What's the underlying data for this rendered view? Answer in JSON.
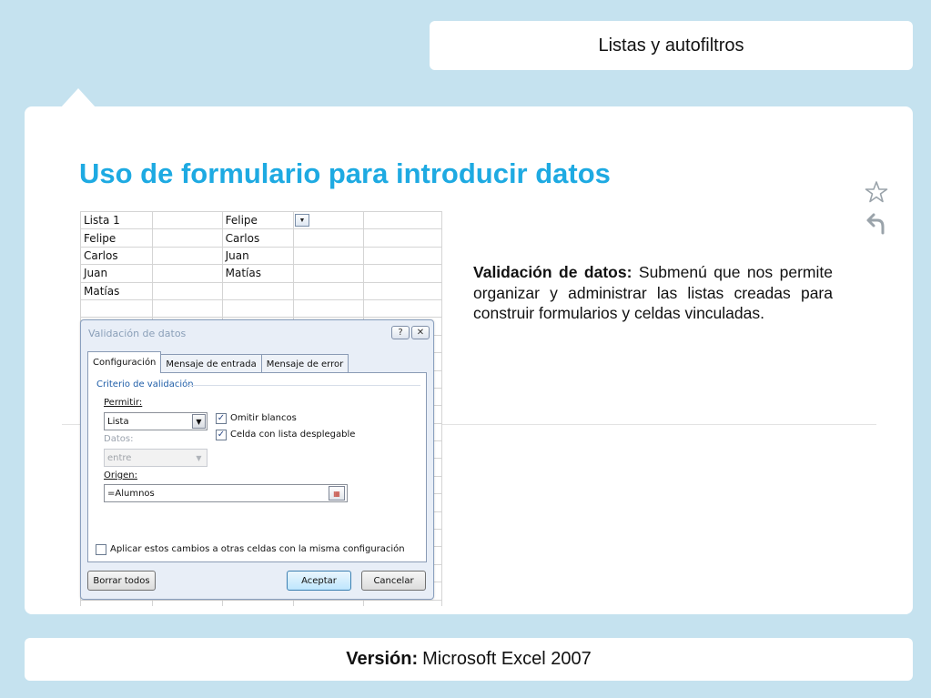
{
  "header": {
    "section_title": "Listas y autofiltros"
  },
  "slide": {
    "title": "Uso de formulario para introducir datos",
    "description_bold": "Validación de datos:",
    "description_text": "Submenú que nos permite organizar y administrar las listas creadas para construir formularios y celdas vinculadas."
  },
  "sheet": {
    "rows": [
      [
        "Lista 1",
        "",
        "Felipe",
        "",
        ""
      ],
      [
        "Felipe",
        "",
        "Carlos",
        "",
        ""
      ],
      [
        "Carlos",
        "",
        "Juan",
        "",
        ""
      ],
      [
        "Juan",
        "",
        "Matías",
        "",
        ""
      ],
      [
        "Matías",
        "",
        "",
        "",
        ""
      ],
      [
        "",
        "",
        "",
        "",
        ""
      ]
    ]
  },
  "dialog": {
    "title": "Validación de datos",
    "help_glyph": "?",
    "close_glyph": "✕",
    "tabs": [
      "Configuración",
      "Mensaje de entrada",
      "Mensaje de error"
    ],
    "group_label": "Criterio de validación",
    "allow_label": "Permitir:",
    "allow_value": "Lista",
    "ignore_blank_label": "Omitir blancos",
    "in_cell_dropdown_label": "Celda con lista desplegable",
    "data_label": "Datos:",
    "data_value": "entre",
    "source_label": "Origen:",
    "source_value": "=Alumnos",
    "apply_all_label": "Aplicar estos cambios a otras celdas con la misma configuración",
    "clear_all_label": "Borrar todos",
    "ok_label": "Aceptar",
    "cancel_label": "Cancelar"
  },
  "footer": {
    "version_label": "Versión:",
    "version_value": "Microsoft Excel 2007"
  },
  "colors": {
    "background": "#c5e2ef",
    "title": "#1eaae2"
  }
}
